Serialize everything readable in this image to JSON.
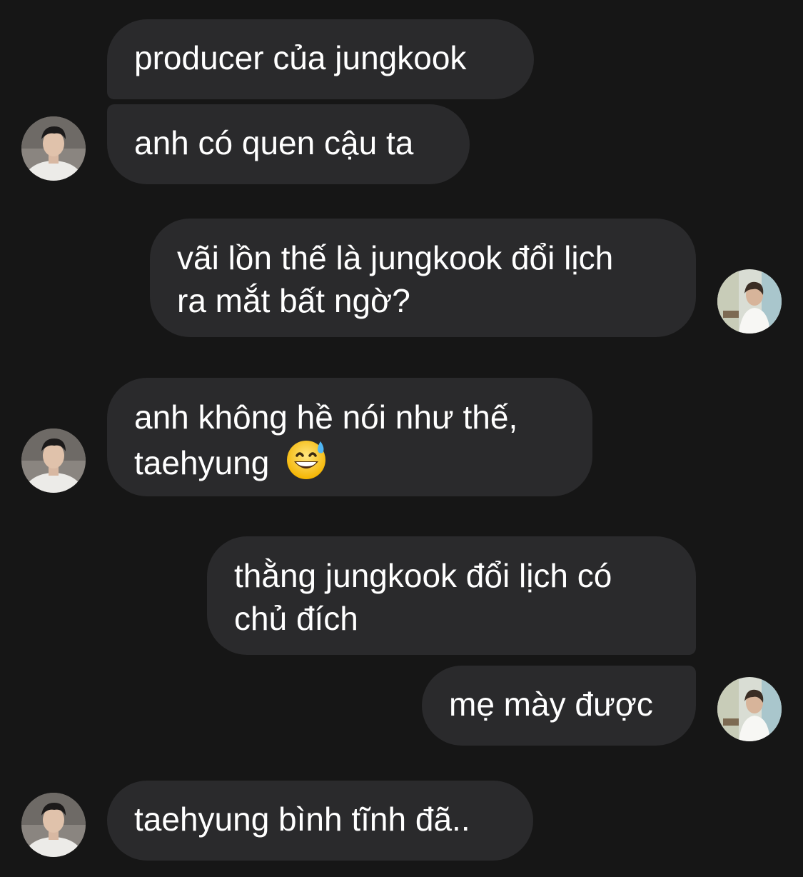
{
  "theme": {
    "background": "#161616",
    "bubble_color": "#2a2a2c",
    "text_color": "#ffffff"
  },
  "messages": [
    {
      "sender": "other",
      "lines": [
        "producer của jungkook"
      ]
    },
    {
      "sender": "other",
      "lines": [
        "anh có quen cậu ta"
      ]
    },
    {
      "sender": "me",
      "lines": [
        "vãi lồn thế là jungkook đổi lịch",
        "ra mắt bất ngờ?"
      ]
    },
    {
      "sender": "other",
      "lines": [
        "anh không hề nói như thế,",
        "taehyung"
      ],
      "emoji": "grinning-face-with-sweat-icon"
    },
    {
      "sender": "me",
      "lines": [
        "thằng jungkook đổi lịch có",
        "chủ đích"
      ]
    },
    {
      "sender": "me",
      "lines": [
        "mẹ mày được"
      ]
    },
    {
      "sender": "other",
      "lines": [
        "taehyung bình tĩnh đã.."
      ]
    }
  ]
}
